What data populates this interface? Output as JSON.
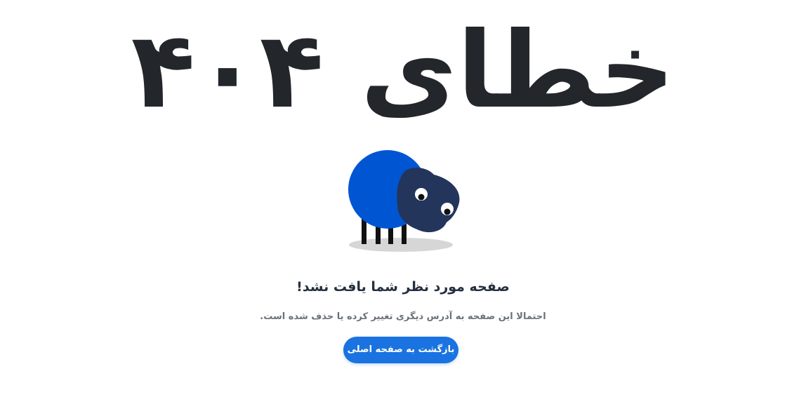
{
  "error": {
    "title": "خطای ۴۰۴"
  },
  "illustration": {
    "name": "sheep",
    "body_color": "#0056d2",
    "head_color": "#24355c",
    "leg_color": "#111111",
    "shadow_color": "#d6d6d6"
  },
  "message": {
    "headline": "صفحه مورد نظر شما یافت نشد!",
    "subline": "احتمالا این صفحه به آدرس دیگری تغییر کرده یا حذف شده است."
  },
  "actions": {
    "home_label": "بازگشت به صفحه اصلی"
  },
  "colors": {
    "accent": "#1a73e0",
    "text": "#23262b"
  }
}
